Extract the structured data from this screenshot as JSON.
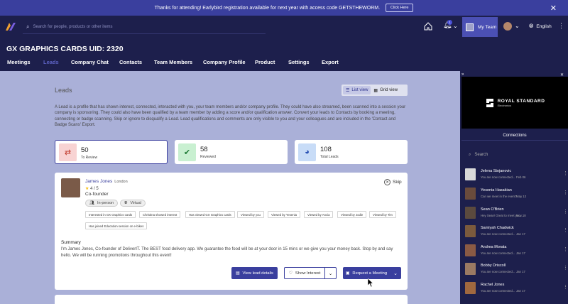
{
  "banner": {
    "text": "Thanks for attending! Earlybird registration available for next year with access code GETSTHEWORM.",
    "button": "Click Here"
  },
  "header": {
    "search_placeholder": "Search for people, products or other items",
    "notif_count": "1",
    "my_team": "My Team",
    "language": "English"
  },
  "page": {
    "title": "GX GRAPHICS CARDS UID: 2320"
  },
  "tabs": [
    "Meetings",
    "Leads",
    "Company Chat",
    "Contacts",
    "Team Members",
    "Company Profile",
    "Product",
    "Settings",
    "Export"
  ],
  "leads": {
    "heading": "Leads",
    "list_view": "List view",
    "grid_view": "Grid view",
    "description": "A Lead is a profile that has shown interest, connected, interacted with you, your team members and/or company profile. They could have also streamed, been scanned into a session your company is sponsoring. They could also have been qualified by a team member by adding a score and/or qualification answer. Convert your leads to Contacts by booking a meeting, connecting or badge scanning. Skip or ignore to disqualify a Lead. Lead qualifications and comments are only visible to you and your colleagues and are included in the 'Contact and Badge Scans' Export.",
    "stats": [
      {
        "value": "50",
        "label": "To Review"
      },
      {
        "value": "58",
        "label": "Reviewed"
      },
      {
        "value": "108",
        "label": "Total Leads"
      }
    ]
  },
  "lead": {
    "name": "James Jones",
    "location": "London",
    "rating": "4 / 5",
    "role": "Co-founder",
    "modes": [
      "In-person",
      "Virtual"
    ],
    "skip": "Skip",
    "tags": [
      "Interested in GX Graphics cards",
      "Christina showed interest",
      "Has viewed GX Graphics cards",
      "Viewed by you",
      "Viewed by Yesenia",
      "Viewed by Ancia",
      "Viewed by Jodie",
      "Viewed by Tim",
      "Has joined Education session on e-bikes"
    ],
    "summary_title": "Summary",
    "summary": "I'm James Jones, Co-founder of DeliverIT. The BEST food delivery app. We guarantee the food will be at your door in 15 mins or we give you your money back. Stop by and say hello. We will be running promotions throughout this event!",
    "btn_view": "View lead details",
    "btn_interest": "Show Interest",
    "btn_meeting": "Request a Meeting"
  },
  "panel": {
    "sponsor_name": "ROYAL STANDARD",
    "sponsor_sub": "Electronics",
    "connections_title": "Connections",
    "search_placeholder": "Search",
    "connections": [
      {
        "name": "Jelena Stojanovic",
        "status": "You are now connected...",
        "date": "Feb 06",
        "color": "#d9d9d9"
      },
      {
        "name": "Yesenia Hasakian",
        "status": "Can we meet in the event?",
        "date": "May 12",
        "color": "#6a4b3c"
      },
      {
        "name": "Sean O'Brien",
        "status": "Hey Sean! Great to meet you...",
        "date": "Nov 18",
        "color": "#5b4a3e"
      },
      {
        "name": "Samiyah Chadwick",
        "status": "You are now connected...",
        "date": "Jan 17",
        "color": "#7b5a3d"
      },
      {
        "name": "Andrea Morata",
        "status": "You are now connected...",
        "date": "Jan 17",
        "color": "#8a5a44"
      },
      {
        "name": "Bobby Driscoll",
        "status": "You are now connected...",
        "date": "Jan 17",
        "color": "#9b7a63"
      },
      {
        "name": "Rachel Jones",
        "status": "You are now connected...",
        "date": "Jan 17",
        "color": "#a0683f"
      }
    ]
  }
}
